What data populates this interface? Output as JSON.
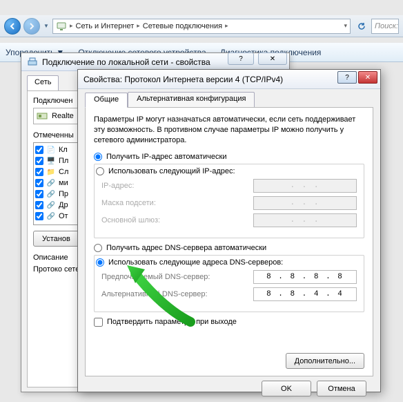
{
  "nav": {
    "bc1": "Сеть и Интернет",
    "bc2": "Сетевые подключения",
    "search_placeholder": "Поиск:"
  },
  "menubar": {
    "organize": "Упорядочить",
    "disable": "Отключение сетевого устройства",
    "diagnose": "Диагностика подключения"
  },
  "dlg1": {
    "title": "Подключение по локальной сети - свойства",
    "tab_net": "Сеть",
    "connect_using": "Подключен",
    "adapter": "Realte",
    "components_label": "Отмеченны",
    "items": [
      "Кл",
      "Пл",
      "Сл",
      "ми",
      "Пр",
      "Др",
      "От"
    ],
    "install_btn": "Установ",
    "desc_label": "Описание",
    "desc_text": "Протоко\nсетей, об\nвзаимод"
  },
  "dlg2": {
    "title": "Свойства: Протокол Интернета версии 4 (TCP/IPv4)",
    "tab_general": "Общие",
    "tab_alt": "Альтернативная конфигурация",
    "intro": "Параметры IP могут назначаться автоматически, если сеть поддерживает эту возможность. В противном случае параметры IP можно получить у сетевого администратора.",
    "ip_auto": "Получить IP-адрес автоматически",
    "ip_manual": "Использовать следующий IP-адрес:",
    "ip_label": "IP-адрес:",
    "mask_label": "Маска подсети:",
    "gw_label": "Основной шлюз:",
    "dns_auto": "Получить адрес DNS-сервера автоматически",
    "dns_manual": "Использовать следующие адреса DNS-серверов:",
    "dns_pref_label": "Предпочитаемый DNS-сервер:",
    "dns_alt_label": "Альтернативный DNS-сервер:",
    "dns_pref_value": "8 . 8 . 8 . 8",
    "dns_alt_value": "8 . 8 . 4 . 4",
    "confirm": "Подтвердить параметры при выходе",
    "advanced": "Дополнительно...",
    "ok": "OK",
    "cancel": "Отмена",
    "ip_placeholder": ".     .     ."
  }
}
